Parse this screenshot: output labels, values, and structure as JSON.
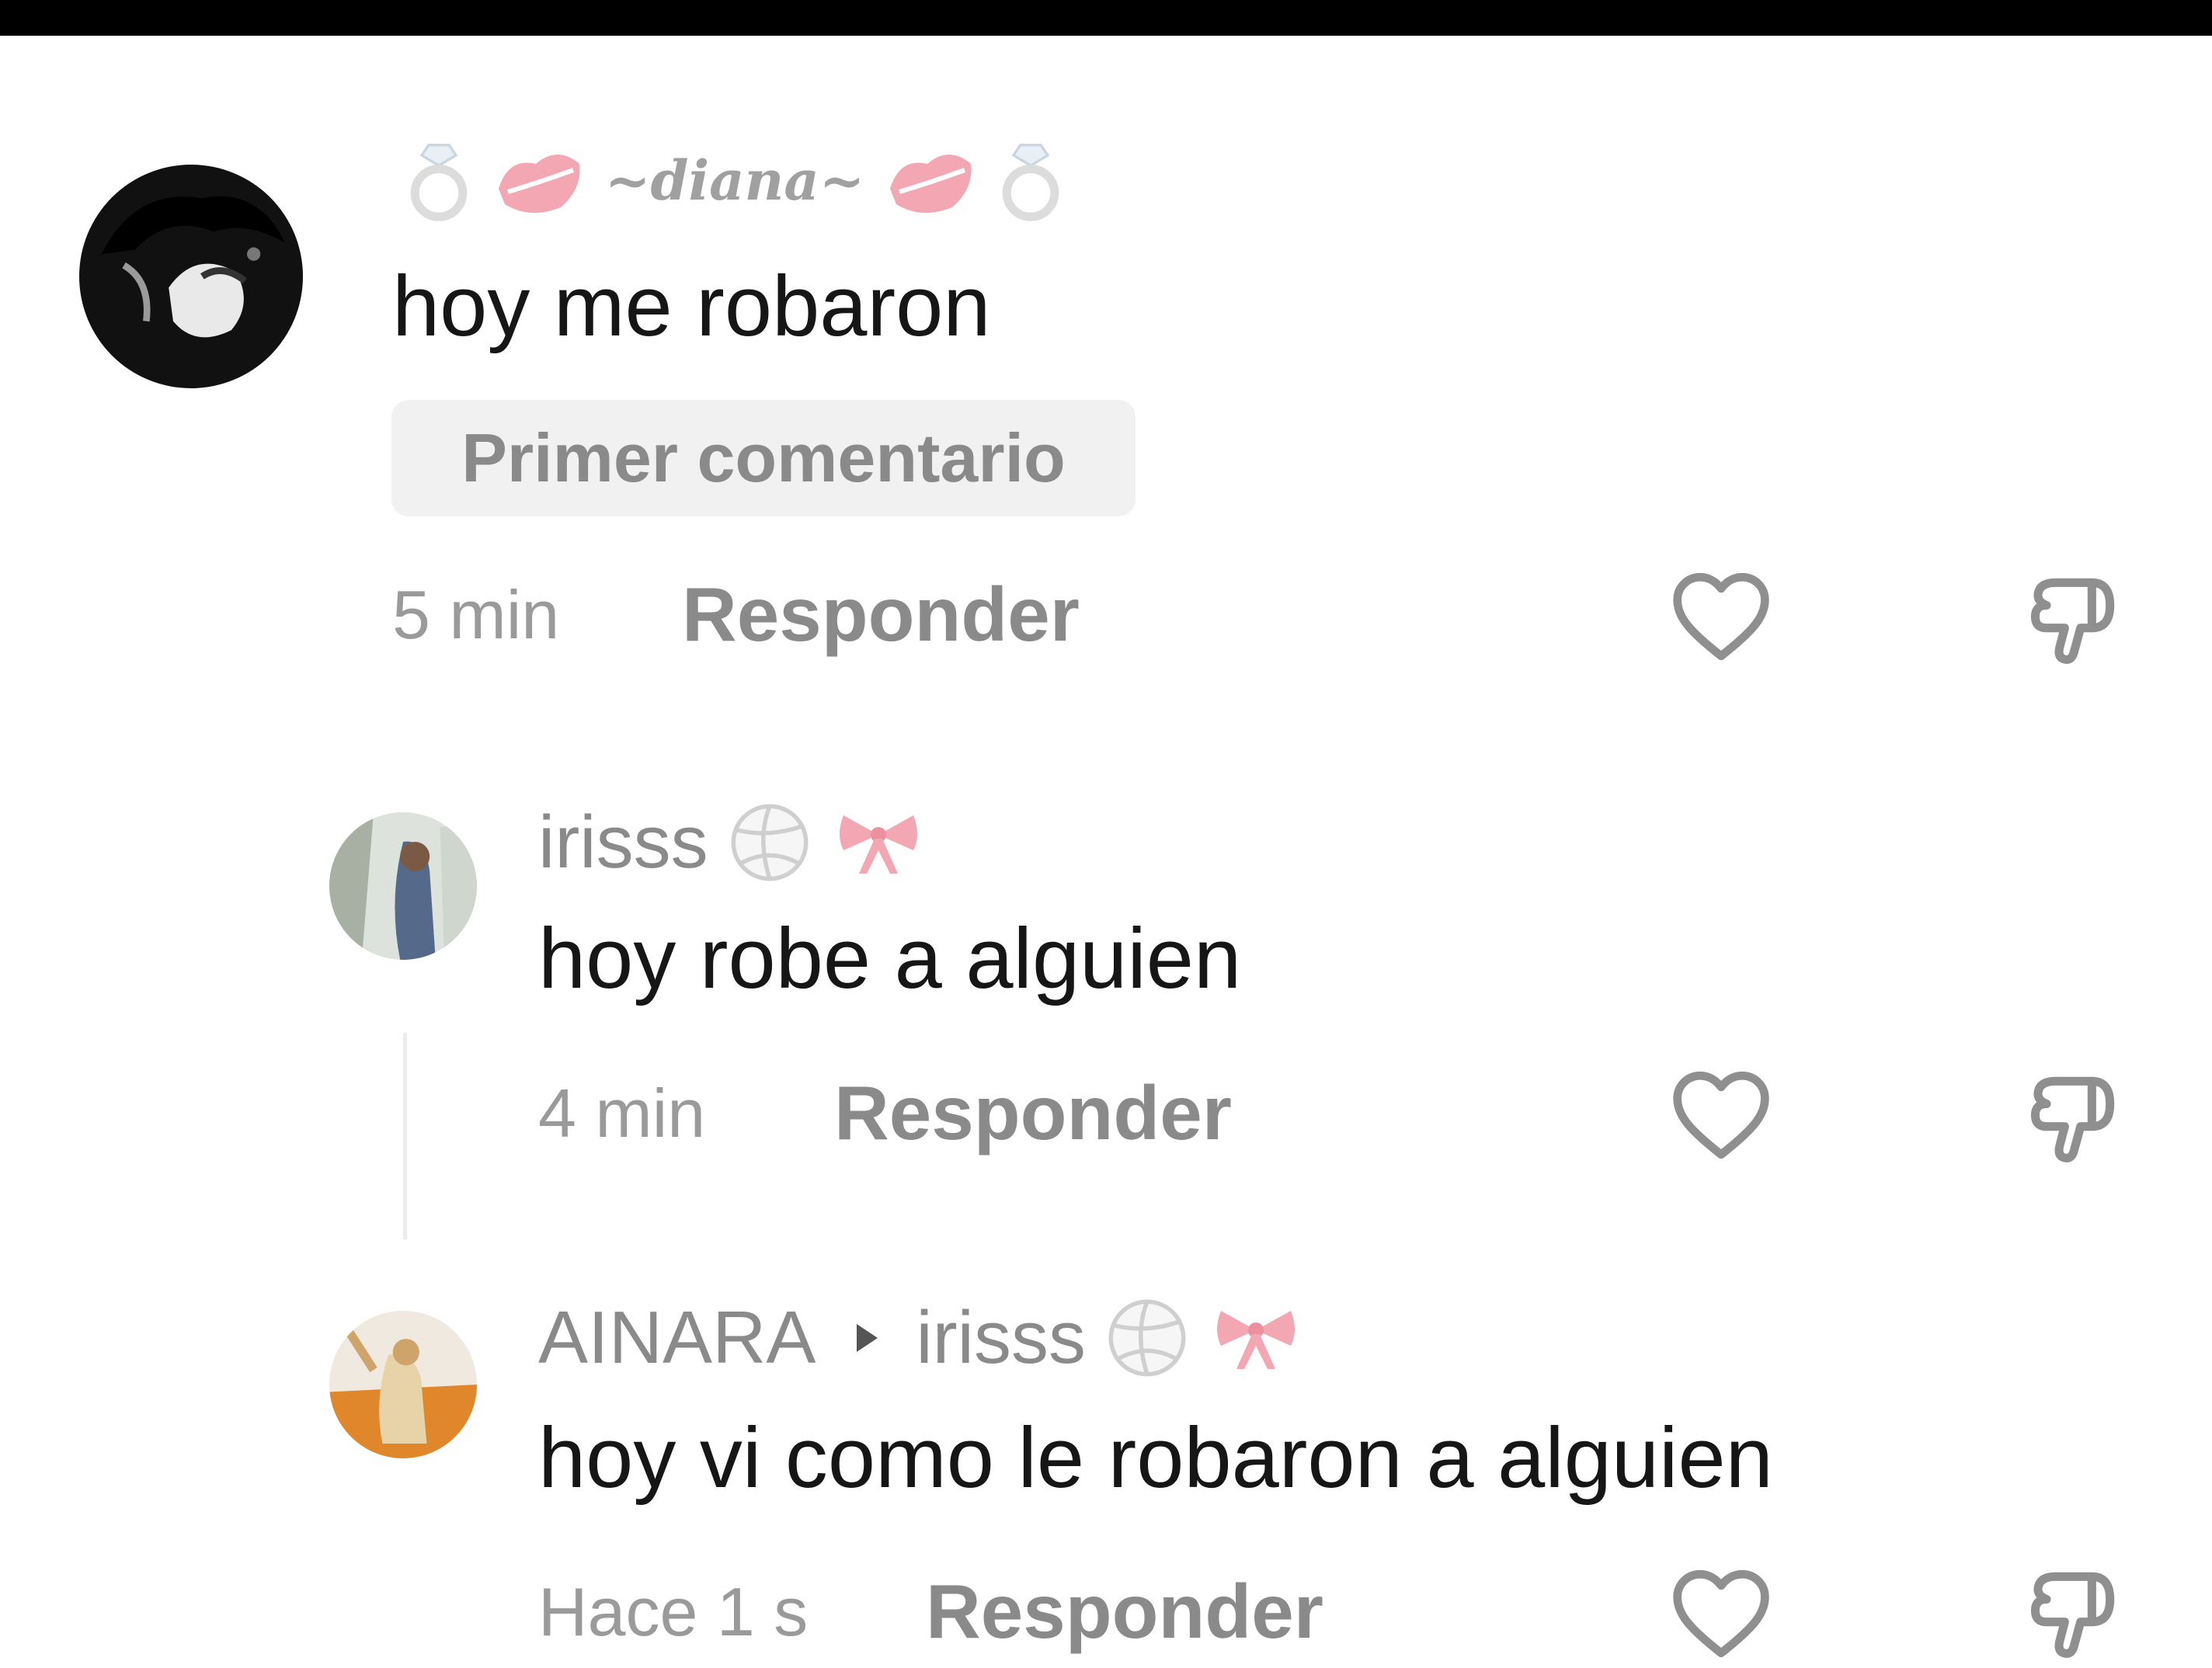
{
  "comments": [
    {
      "username": "~diana~",
      "text": "hoy me robaron",
      "badge": "Primer comentario",
      "time": "5 min",
      "reply_label": "Responder"
    },
    {
      "username": "irisss",
      "text": "hoy robe a alguien",
      "time": "4 min",
      "reply_label": "Responder"
    },
    {
      "username": "AINARA",
      "reply_to": "irisss",
      "text": "hoy vi como le robaron a alguien",
      "time": "Hace 1 s",
      "reply_label": "Responder"
    }
  ],
  "icons": {
    "like": "heart-outline-icon",
    "dislike": "thumbs-down-outline-icon",
    "reply_arrow": "triangle-right-icon",
    "emojis": [
      "ring-emoji",
      "lips-emoji",
      "volleyball-emoji",
      "ribbon-bow-emoji"
    ]
  },
  "colors": {
    "text_primary": "#161616",
    "text_secondary": "#8a8a8a",
    "badge_bg": "#f1f1f1",
    "emoji_pink": "#f2a7b3"
  }
}
